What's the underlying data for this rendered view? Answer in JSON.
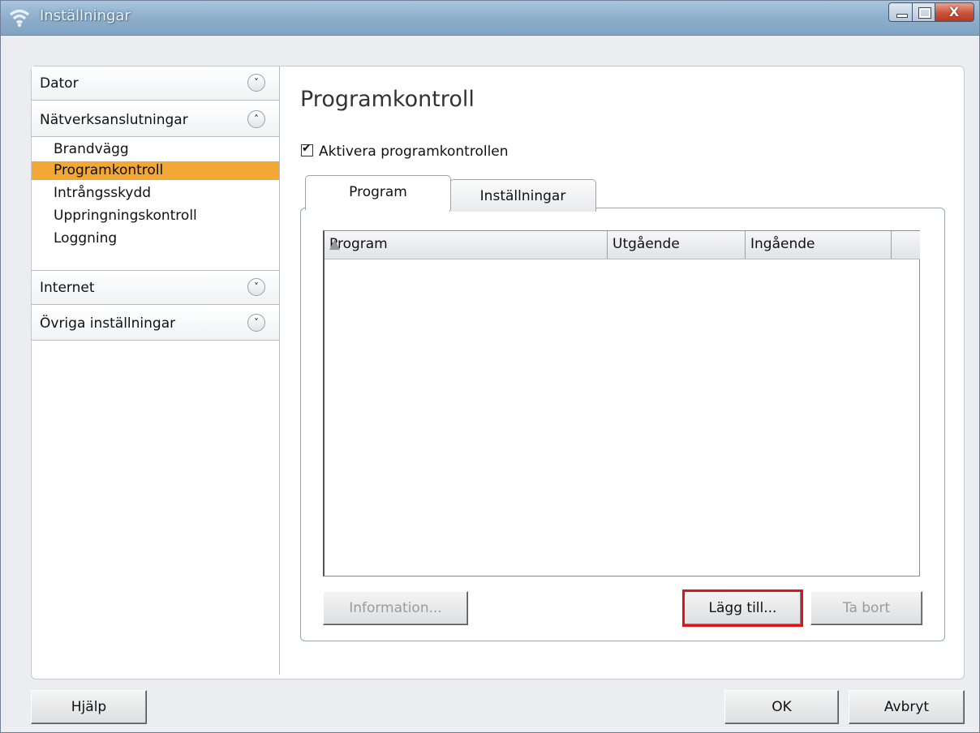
{
  "window": {
    "title": "Inställningar",
    "close_glyph": "X"
  },
  "sidebar": {
    "sections": [
      {
        "label": "Dator",
        "expanded": false
      },
      {
        "label": "Nätverksanslutningar",
        "expanded": true
      },
      {
        "label": "Internet",
        "expanded": false
      },
      {
        "label": "Övriga inställningar",
        "expanded": false
      }
    ],
    "items": [
      {
        "label": "Brandvägg",
        "active": false
      },
      {
        "label": "Programkontroll",
        "active": true
      },
      {
        "label": "Intrångsskydd",
        "active": false
      },
      {
        "label": "Uppringningskontroll",
        "active": false
      },
      {
        "label": "Loggning",
        "active": false
      }
    ],
    "chevron_down": "˅",
    "chevron_up": "˄"
  },
  "main": {
    "title": "Programkontroll",
    "checkbox_label": "Aktivera programkontrollen",
    "checkbox_checked": true,
    "tabs": [
      {
        "label": "Program",
        "active": true
      },
      {
        "label": "Inställningar",
        "active": false
      }
    ],
    "table": {
      "columns": [
        "Program",
        "Utgående",
        "Ingående"
      ],
      "sort_icon": "▲",
      "rows": []
    },
    "buttons": {
      "information": "Information...",
      "add": "Lägg till...",
      "remove": "Ta bort"
    }
  },
  "footer": {
    "help": "Hjälp",
    "ok": "OK",
    "cancel": "Avbryt"
  },
  "colors": {
    "selected_item": "#f3a835",
    "highlight": "#e0121a"
  }
}
